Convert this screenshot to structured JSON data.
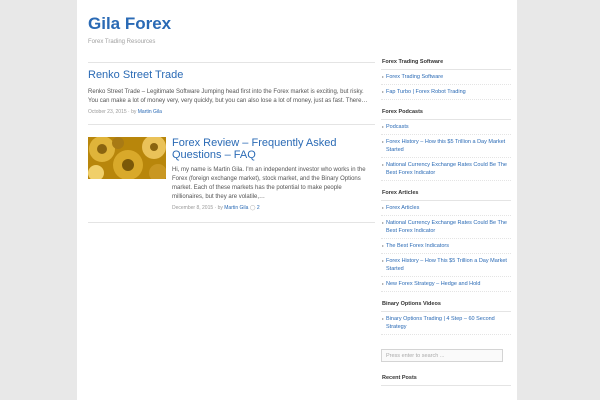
{
  "site": {
    "title": "Gila Forex",
    "description": "Forex Trading Resources"
  },
  "posts": [
    {
      "title": "Renko Street Trade",
      "excerpt": "Renko Street Trade – Legitimate Software Jumping head first into the Forex market is exciting, but risky. You can make a lot of money very, very quickly, but you can also lose a lot of money, just as fast. There…",
      "date": "October 23, 2015",
      "by": "by",
      "author": "Martin Gila"
    },
    {
      "title": "Forex Review – Frequently Asked Questions – FAQ",
      "excerpt": "Hi, my name is Martin Gila. I'm an independent investor who works in the Forex (foreign exchange market), stock market, and the Binary Options market. Each of these markets has the potential to make people millionaires, but they are volatile,…",
      "date": "December 8, 2015",
      "by": "by",
      "author": "Martin Gila",
      "comments": "2"
    }
  ],
  "sidebar": {
    "widgets": [
      {
        "title": "Forex Trading Software",
        "items": [
          "Forex Trading Software",
          "Fap Turbo | Forex Robot Trading"
        ]
      },
      {
        "title": "Forex Podcasts",
        "items": [
          "Podcasts",
          "Forex History – How this $5 Trillion a Day Market Started",
          "National Currency Exchange Rates Could Be The Best Forex Indicator"
        ]
      },
      {
        "title": "Forex Articles",
        "items": [
          "Forex Articles",
          "National Currency Exchange Rates Could Be The Best Forex Indicator",
          "The Best Forex Indicators",
          "Forex History – How This $5 Trillion a Day Market Started",
          "New Forex Strategy – Hedge and Hold"
        ]
      },
      {
        "title": "Binary Options Videos",
        "items": [
          "Binary Options Trading | 4 Step – 60 Second Strategy"
        ]
      }
    ],
    "search_placeholder": "Press enter to search ...",
    "recent_title": "Recent Posts"
  },
  "colors": {
    "link": "#2a6ab5",
    "background": "#e8e8e8",
    "thumbnail": "#c79b22"
  }
}
